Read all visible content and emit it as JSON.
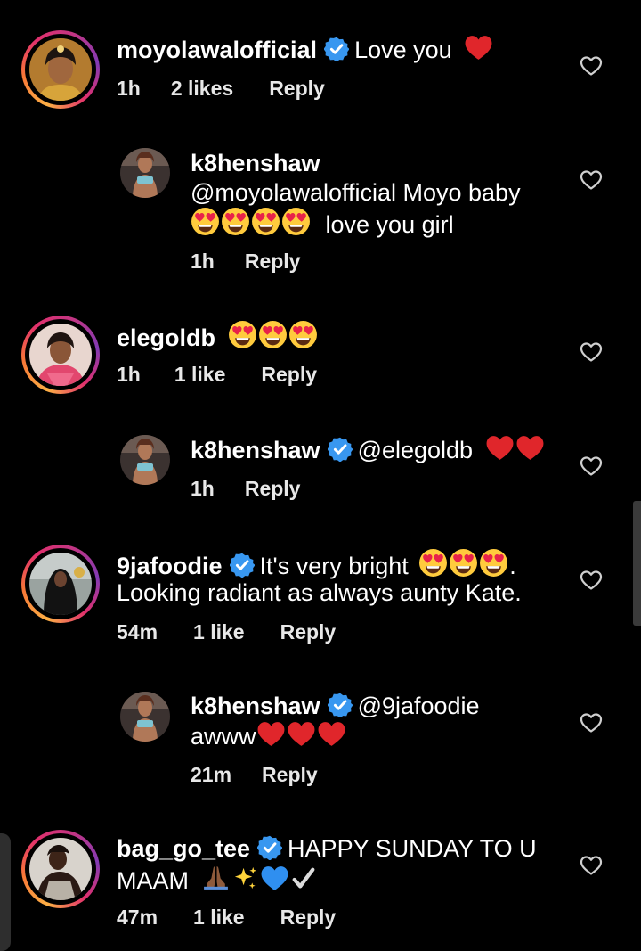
{
  "comments": [
    {
      "username": "moyolawalofficial",
      "verified": true,
      "text": "Love you",
      "emoji": [
        "red-heart"
      ],
      "time": "1h",
      "likes": "2 likes",
      "reply": "Reply"
    },
    {
      "username": "k8henshaw",
      "verified": false,
      "text_line1": "@moyolawalofficial Moyo baby",
      "text_line2": "love you girl",
      "emoji": [
        "heart-eyes",
        "heart-eyes",
        "heart-eyes",
        "heart-eyes"
      ],
      "time": "1h",
      "reply": "Reply"
    },
    {
      "username": "elegoldb",
      "verified": false,
      "text": "",
      "emoji": [
        "heart-eyes",
        "heart-eyes",
        "heart-eyes"
      ],
      "time": "1h",
      "likes": "1 like",
      "reply": "Reply"
    },
    {
      "username": "k8henshaw",
      "verified": true,
      "text": "@elegoldb",
      "emoji": [
        "red-heart",
        "red-heart"
      ],
      "time": "1h",
      "reply": "Reply"
    },
    {
      "username": "9jafoodie",
      "verified": true,
      "text": "It's very bright",
      "text_after_emoji": ".",
      "text_line2": "Looking radiant as always aunty Kate.",
      "emoji": [
        "heart-eyes",
        "heart-eyes",
        "heart-eyes"
      ],
      "time": "54m",
      "likes": "1 like",
      "reply": "Reply"
    },
    {
      "username": "k8henshaw",
      "verified": true,
      "text": "@9jafoodie",
      "text_line2": "awww",
      "emoji": [
        "red-heart",
        "red-heart",
        "red-heart"
      ],
      "time": "21m",
      "reply": "Reply"
    },
    {
      "username": "bag_go_tee",
      "verified": true,
      "text": "HAPPY SUNDAY TO U",
      "text_line2": "MAAM",
      "emoji": [
        "folded-hands",
        "sparkles",
        "blue-heart",
        "check-mark"
      ],
      "time": "47m",
      "likes": "1 like",
      "reply": "Reply"
    }
  ],
  "icons": {
    "like": "heart-outline-icon",
    "verified": "verified-badge-icon"
  },
  "colors": {
    "background": "#000000",
    "verified_blue": "#3897f0",
    "heart_red": "#e0262b",
    "story_ring": "#e1306c"
  }
}
